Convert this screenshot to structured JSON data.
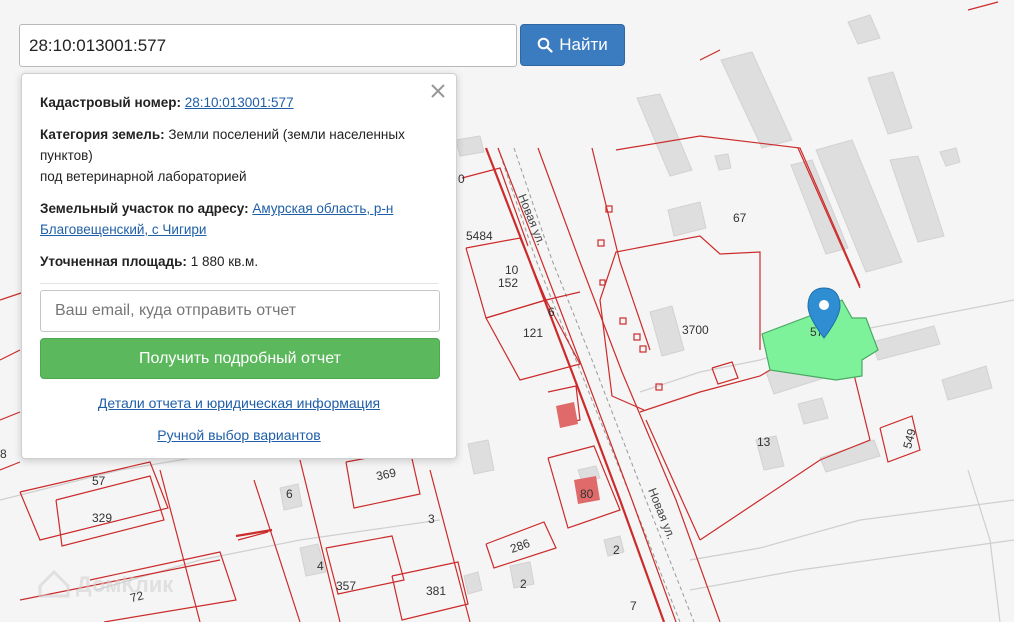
{
  "search": {
    "value": "28:10:013001:577",
    "button_label": "Найти"
  },
  "popup": {
    "cadastral_label": "Кадастровый номер:",
    "cadastral_value": "28:10:013001:577",
    "category_label": "Категория земель:",
    "category_value": "Земли поселений (земли населенных пунктов)",
    "category_note": "под ветеринарной лабораторией",
    "address_label": "Земельный участок по адресу:",
    "address_value": "Амурская область, р-н Благовещенский, с Чигири",
    "area_label": "Уточненная площадь:",
    "area_value": "1 880 кв.м.",
    "email_placeholder": "Ваш email, куда отправить отчет",
    "report_button": "Получить подробный отчет",
    "details_link": "Детали отчета и юридическая информация",
    "manual_link": "Ручной выбор вариантов"
  },
  "map": {
    "plot_labels": [
      "5484",
      "10",
      "152",
      "6",
      "121",
      "3700",
      "67",
      "57",
      "13",
      "549",
      "369",
      "6",
      "3",
      "57",
      "329",
      "80",
      "286",
      "2",
      "2",
      "4",
      "357",
      "381",
      "72",
      "8",
      "7",
      "0"
    ],
    "street_labels": [
      "Новая ул.",
      "Новая ул."
    ],
    "selected_label": "57",
    "watermark": "ДомКлик"
  },
  "colors": {
    "boundary": "#cc2b2b",
    "selected_fill": "#7ef29b",
    "building": "#dcdcdc",
    "marker": "#2f8ed1",
    "button_blue": "#3b7cc0",
    "button_green": "#5cb85c"
  }
}
